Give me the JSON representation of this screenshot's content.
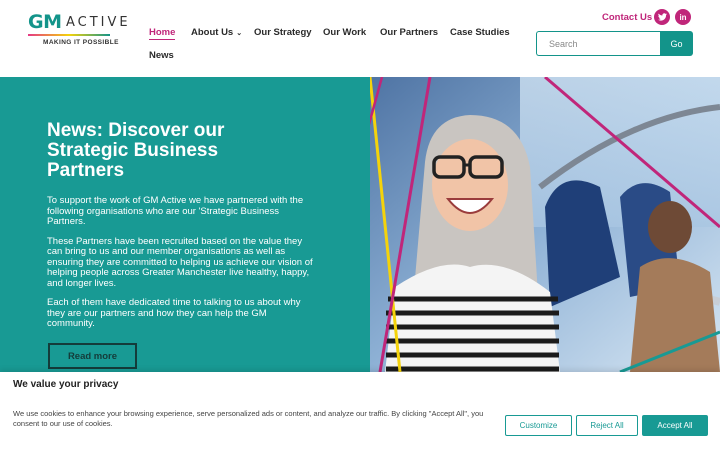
{
  "logo": {
    "gm": "GM",
    "active": "ACTIVE",
    "tagline": "MAKING IT POSSIBLE"
  },
  "nav": {
    "items": [
      {
        "label": "Home",
        "active": true
      },
      {
        "label": "About Us",
        "dropdown": true
      },
      {
        "label": "Our Strategy"
      },
      {
        "label": "Our Work"
      },
      {
        "label": "Our Partners"
      },
      {
        "label": "Case Studies"
      },
      {
        "label": "News"
      }
    ],
    "about_chevron": "⌄"
  },
  "header": {
    "contact": "Contact Us",
    "twitter_icon": "twitter-icon",
    "linkedin_icon": "linkedin-icon",
    "linkedin_glyph": "in",
    "search_placeholder": "Search",
    "go_label": "Go"
  },
  "hero": {
    "title": "News: Discover our Strategic Business Partners",
    "p1": "To support the work of GM Active we have partnered with the following organisations who are our 'Strategic Business Partners.",
    "p2": "These Partners have been recruited based on the value they can bring to us and our member organisations as well as ensuring they are committed to helping us achieve our vision of helping people across Greater Manchester live healthy, happy, and longer lives.",
    "p3": "Each of them have dedicated time to talking to us about why they are our partners and how they can help the GM community.",
    "read_more": "Read more"
  },
  "cookie": {
    "title": "We value your privacy",
    "text": "We use cookies to enhance your browsing experience, serve personalized ads or content, and analyze our traffic. By clicking \"Accept All\", you consent to our use of cookies.",
    "customize": "Customize",
    "reject": "Reject All",
    "accept": "Accept All"
  },
  "colors": {
    "teal": "#189a94",
    "magenta": "#c0267a",
    "yellow": "#f4d30b"
  }
}
